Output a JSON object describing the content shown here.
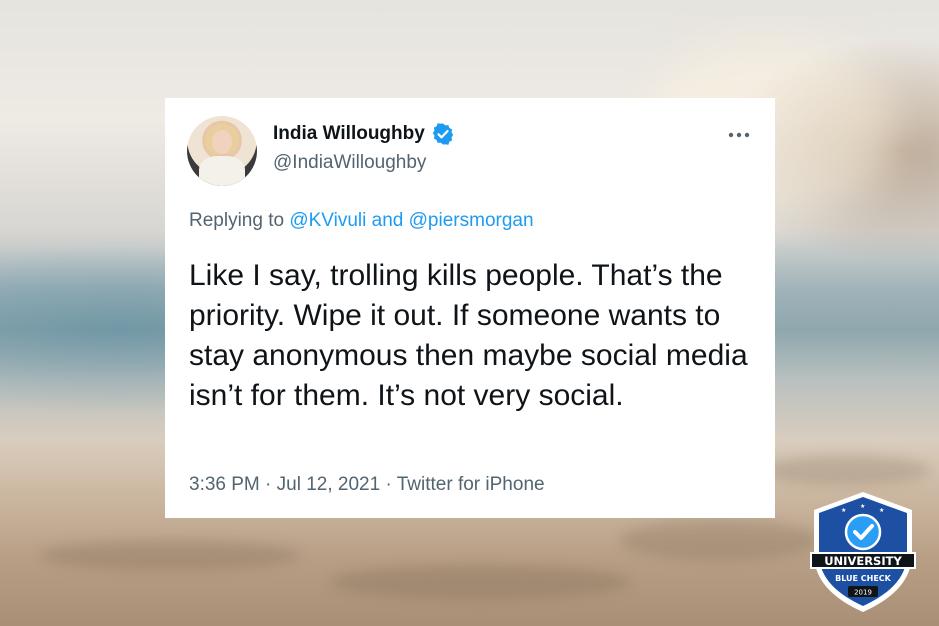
{
  "tweet": {
    "display_name": "India Willoughby",
    "handle": "@IndiaWilloughby",
    "replying_prefix": "Replying to",
    "reply_mention_1": "@KVivuli",
    "reply_and": "and",
    "reply_mention_2": "@piersmorgan",
    "text": "Like I say, trolling kills people. That’s the priority. Wipe it out. If someone wants to stay anonymous then maybe social media isn’t for them. It’s not very social.",
    "time": "3:36 PM",
    "date": "Jul 12, 2021",
    "source": "Twitter for iPhone",
    "separator": "·"
  },
  "badge": {
    "line1": "UNIVERSITY",
    "line2": "BLUE CHECK",
    "year": "2019",
    "color": "#1d4fa3"
  },
  "colors": {
    "verified": "#1d9bf0",
    "link": "#1d9bf0",
    "text": "#0f1419",
    "muted": "#536471"
  },
  "icons": {
    "verified": "verified-badge-icon",
    "more": "more-options-icon"
  }
}
